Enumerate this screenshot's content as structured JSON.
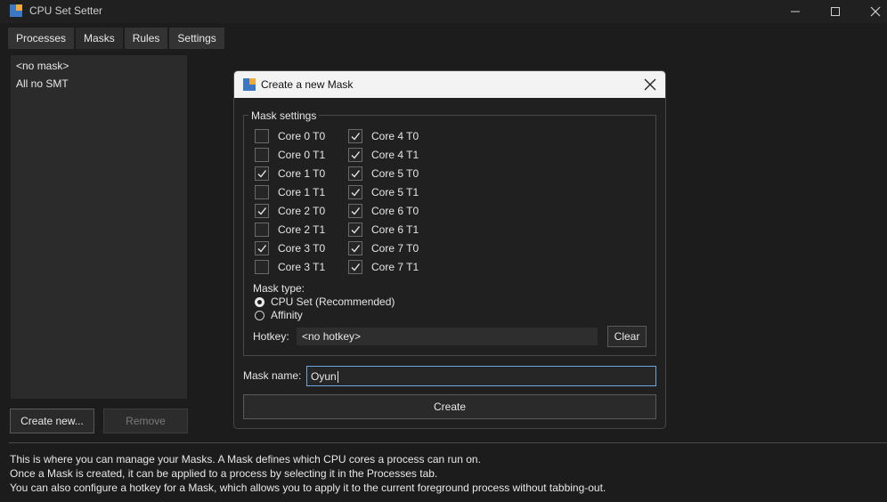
{
  "window": {
    "title": "CPU Set Setter"
  },
  "tabs": [
    {
      "label": "Processes"
    },
    {
      "label": "Masks"
    },
    {
      "label": "Rules"
    },
    {
      "label": "Settings"
    }
  ],
  "mask_list": {
    "items": [
      "<no mask>",
      "All no SMT"
    ]
  },
  "buttons": {
    "create_new": "Create new...",
    "remove": "Remove"
  },
  "info": {
    "line1": "This is where you can manage your Masks. A Mask defines which CPU cores a process can run on.",
    "line2": "Once a Mask is created, it can be applied to a process by selecting it in the Processes tab.",
    "line3": "You can also configure a hotkey for a Mask, which allows you to apply it to the current foreground process without tabbing-out."
  },
  "dialog": {
    "title": "Create a new Mask",
    "group_title": "Mask settings",
    "cores_left": [
      {
        "label": "Core 0 T0",
        "checked": false
      },
      {
        "label": "Core 0 T1",
        "checked": false
      },
      {
        "label": "Core 1 T0",
        "checked": true
      },
      {
        "label": "Core 1 T1",
        "checked": false
      },
      {
        "label": "Core 2 T0",
        "checked": true
      },
      {
        "label": "Core 2 T1",
        "checked": false
      },
      {
        "label": "Core 3 T0",
        "checked": true
      },
      {
        "label": "Core 3 T1",
        "checked": false
      }
    ],
    "cores_right": [
      {
        "label": "Core 4 T0",
        "checked": true
      },
      {
        "label": "Core 4 T1",
        "checked": true
      },
      {
        "label": "Core 5 T0",
        "checked": true
      },
      {
        "label": "Core 5 T1",
        "checked": true
      },
      {
        "label": "Core 6 T0",
        "checked": true
      },
      {
        "label": "Core 6 T1",
        "checked": true
      },
      {
        "label": "Core 7 T0",
        "checked": true
      },
      {
        "label": "Core 7 T1",
        "checked": true
      }
    ],
    "mask_type_label": "Mask type:",
    "mask_type_options": [
      {
        "label": "CPU Set (Recommended)",
        "selected": true
      },
      {
        "label": "Affinity",
        "selected": false
      }
    ],
    "hotkey_label": "Hotkey:",
    "hotkey_value": "<no hotkey>",
    "clear_label": "Clear",
    "mask_name_label": "Mask name:",
    "mask_name_value": "Oyun",
    "create_label": "Create"
  }
}
